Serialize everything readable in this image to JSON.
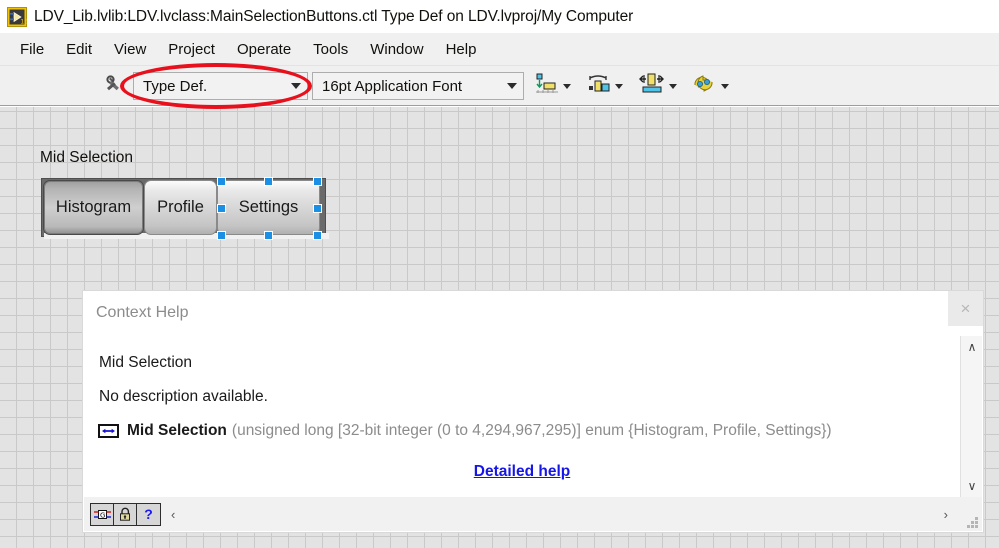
{
  "window": {
    "title": "LDV_Lib.lvlib:LDV.lvclass:MainSelectionButtons.ctl Type Def on LDV.lvproj/My Computer",
    "icon": "labview-control-icon"
  },
  "menubar": {
    "items": [
      {
        "label": "File",
        "name": "menu-file"
      },
      {
        "label": "Edit",
        "name": "menu-edit"
      },
      {
        "label": "View",
        "name": "menu-view"
      },
      {
        "label": "Project",
        "name": "menu-project"
      },
      {
        "label": "Operate",
        "name": "menu-operate"
      },
      {
        "label": "Tools",
        "name": "menu-tools"
      },
      {
        "label": "Window",
        "name": "menu-window"
      },
      {
        "label": "Help",
        "name": "menu-help"
      }
    ]
  },
  "toolbar": {
    "wrench_icon": "wrench-icon",
    "typedef_combo": {
      "value": "Type Def.",
      "icon": "chevron-down-icon"
    },
    "font_combo": {
      "value": "16pt Application Font",
      "icon": "chevron-down-icon"
    },
    "icon_buttons": [
      {
        "name": "align-objects-button",
        "icon": "align-objects-icon"
      },
      {
        "name": "distribute-objects-button",
        "icon": "distribute-objects-icon"
      },
      {
        "name": "resize-objects-button",
        "icon": "resize-objects-icon"
      },
      {
        "name": "reorder-objects-button",
        "icon": "reorder-objects-icon"
      }
    ]
  },
  "panel": {
    "control_label": "Mid Selection",
    "buttons": [
      {
        "label": "Histogram",
        "state": "pressed",
        "name": "segment-button-histogram"
      },
      {
        "label": "Profile",
        "state": "normal",
        "name": "segment-button-profile"
      },
      {
        "label": "Settings",
        "state": "selected",
        "name": "segment-button-settings"
      }
    ]
  },
  "context_help": {
    "title": "Context Help",
    "close_label": "×",
    "item_name": "Mid Selection",
    "description": "No description available.",
    "type_glyph": "enum-terminal-icon",
    "type_name": "Mid Selection",
    "type_detail": "(unsigned long [32-bit integer (0 to 4,294,967,295)] enum {Histogram, Profile, Settings})",
    "detailed_help_label": "Detailed help",
    "scroll_up": "∧",
    "scroll_down": "∨",
    "scroll_left": "‹",
    "scroll_right": "›",
    "buttons": [
      {
        "name": "show-optional-terminals-button",
        "icon": "terminals-icon"
      },
      {
        "name": "lock-context-help-button",
        "icon": "lock-icon"
      },
      {
        "name": "detailed-help-button",
        "icon": "question-mark-icon",
        "glyph": "?"
      }
    ]
  },
  "annotation": {
    "shape": "red-ellipse-highlight",
    "color": "#e8101c",
    "target": "Type Def."
  }
}
